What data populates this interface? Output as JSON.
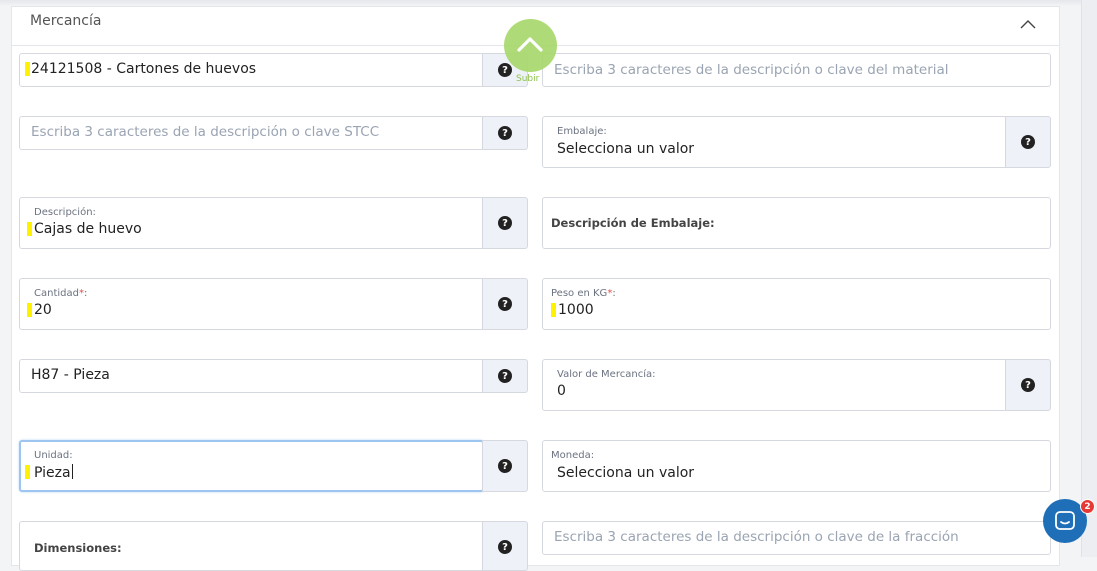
{
  "section": {
    "title": "Mercancía"
  },
  "scroll_top": {
    "label": "Subir"
  },
  "fields": {
    "material_code": {
      "value": "24121508 - Cartones de huevos"
    },
    "material_search": {
      "placeholder": "Escriba 3 caracteres de la descripción o clave del material"
    },
    "stcc_search": {
      "placeholder": "Escriba 3 caracteres de la descripción o clave STCC"
    },
    "embalaje": {
      "label": "Embalaje:",
      "value": "Selecciona un valor"
    },
    "descripcion": {
      "label": "Descripción:",
      "value": "Cajas de huevo"
    },
    "descripcion_embalaje": {
      "label": "Descripción de Embalaje:"
    },
    "cantidad": {
      "label": "Cantidad",
      "required": "*",
      "suffix": ":",
      "value": "20"
    },
    "peso": {
      "label": "Peso en KG",
      "required": "*",
      "suffix": ":",
      "value": "1000"
    },
    "clave_unidad": {
      "value": "H87 - Pieza"
    },
    "valor_mercancia": {
      "label": "Valor de Mercancía:",
      "value": "0"
    },
    "unidad": {
      "label": "Unidad:",
      "value": "Pieza"
    },
    "moneda": {
      "label": "Moneda:",
      "value": "Selecciona un valor"
    },
    "dimensiones": {
      "label": "Dimensiones:"
    },
    "fraccion_search": {
      "placeholder": "Escriba 3 caracteres de la descripción o clave de la fracción"
    }
  },
  "help_icon_glyph": "?",
  "chat": {
    "badge": "2"
  },
  "colors": {
    "highlight": "#fff200",
    "subir": "#a6d86a",
    "chat": "#1f6fb8",
    "required": "#e54c4c"
  }
}
